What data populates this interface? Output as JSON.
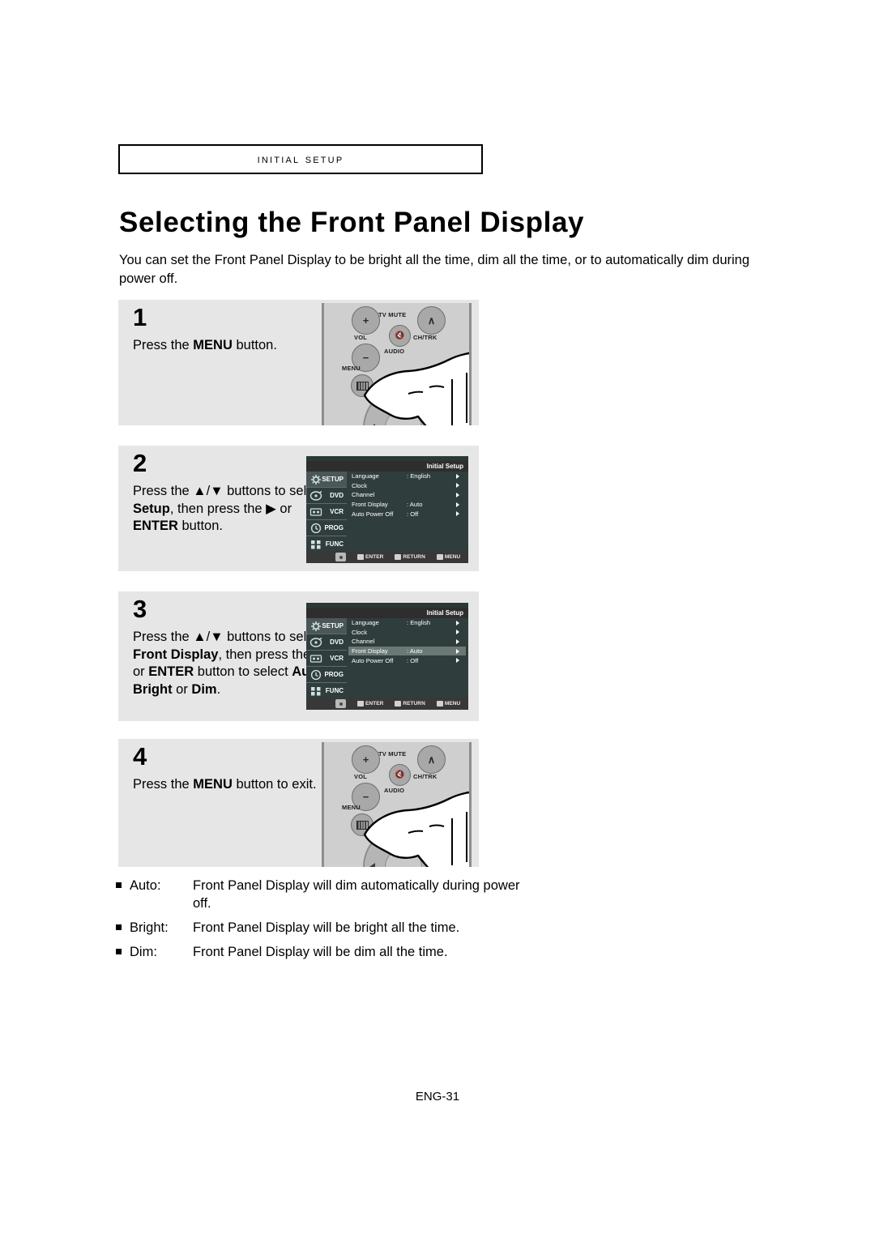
{
  "header": {
    "chapter_label": "Initial Setup"
  },
  "page_title": "Selecting the Front Panel Display",
  "intro": "You can set the Front Panel Display to be bright all the time, dim all the time, or to automatically dim during power off.",
  "steps": [
    {
      "number": "1",
      "text_html": "Press the <b>MENU</b> button.",
      "illustration": "remote-control"
    },
    {
      "number": "2",
      "text_html": "Press the ▲/▼ buttons to select <b>Setup</b>, then press the ▶ or <b>ENTER</b> button.",
      "illustration": "osd-menu"
    },
    {
      "number": "3",
      "text_html": "Press the ▲/▼ buttons to select <b>Front Display</b>, then press the ▶ or <b>ENTER</b> button to select <b>Auto</b>, <b>Bright</b> or <b>Dim</b>.",
      "illustration": "osd-menu"
    },
    {
      "number": "4",
      "text_html": "Press the <b>MENU</b> button to exit.",
      "illustration": "remote-control"
    }
  ],
  "osd": {
    "title": "Initial Setup",
    "sidebar": [
      {
        "label": "SETUP",
        "icon": "gear-icon",
        "active": true
      },
      {
        "label": "DVD",
        "icon": "disc-icon",
        "active": false
      },
      {
        "label": "VCR",
        "icon": "cassette-icon",
        "active": false
      },
      {
        "label": "PROG",
        "icon": "clock-icon",
        "active": false
      },
      {
        "label": "FUNC",
        "icon": "blocks-icon",
        "active": false
      }
    ],
    "items": [
      {
        "name": "Language",
        "value": ": English"
      },
      {
        "name": "Clock",
        "value": ""
      },
      {
        "name": "Channel",
        "value": ""
      },
      {
        "name": "Front Display",
        "value": ": Auto"
      },
      {
        "name": "Auto Power Off",
        "value": ": Off"
      }
    ],
    "highlighted_item_step2": -1,
    "highlighted_item_step3": 3,
    "bottom_bar": [
      {
        "label": "ENTER",
        "icon": "enter-icon"
      },
      {
        "label": "RETURN",
        "icon": "return-icon"
      },
      {
        "label": "MENU",
        "icon": "menu-icon"
      }
    ]
  },
  "remote": {
    "labels": {
      "vol": "VOL",
      "tv_mute": "TV MUTE",
      "ch_trk": "CH/TRK",
      "audio": "AUDIO",
      "menu": "MENU",
      "vol_plus": "+",
      "vol_minus": "−",
      "ch_up": "∧"
    }
  },
  "bullets": [
    {
      "term": "Auto:",
      "desc": "Front Panel Display will dim automatically during power off."
    },
    {
      "term": "Bright:",
      "desc": "Front Panel Display will be bright all the time."
    },
    {
      "term": "Dim:",
      "desc": "Front Panel Display will be dim all the time."
    }
  ],
  "footer": "ENG-31",
  "colors": {
    "step_background": "#e6e6e6",
    "osd_background": "#2f3e3c",
    "osd_titlebar": "#2e2e2e",
    "osd_highlight": "#6a7876",
    "remote_body": "#cfcfcf"
  }
}
